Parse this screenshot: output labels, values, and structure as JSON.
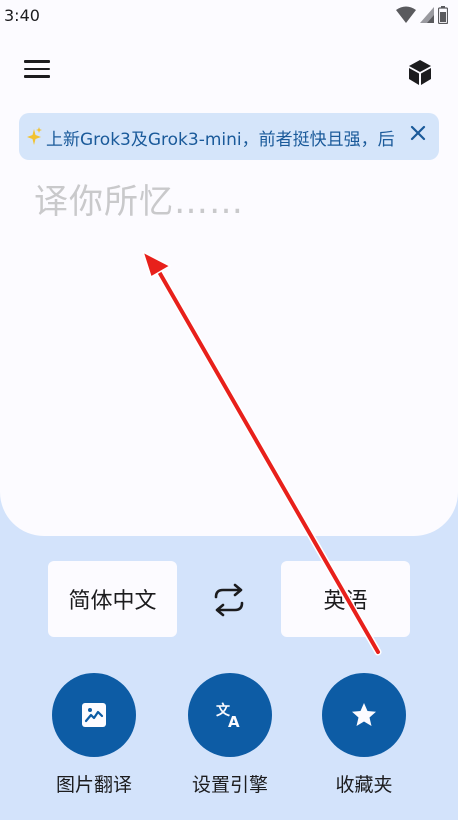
{
  "status": {
    "time": "3:40",
    "icons": [
      "wifi-icon",
      "signal-icon",
      "battery-icon"
    ]
  },
  "header": {
    "menu_icon": "hamburger-menu-icon",
    "right_icon": "cube-icon"
  },
  "announcement": {
    "icon": "sparkle-icon",
    "text": "上新Grok3及Grok3-mini，前者挺快且强，后",
    "close_icon": "close-icon"
  },
  "input": {
    "placeholder": "译你所忆……",
    "value": ""
  },
  "languages": {
    "source": "简体中文",
    "target": "英语",
    "swap_icon": "swap-arrows-icon"
  },
  "actions": [
    {
      "label": "图片翻译",
      "icon": "image-icon"
    },
    {
      "label": "设置引擎",
      "icon": "translate-icon"
    },
    {
      "label": "收藏夹",
      "icon": "star-icon"
    }
  ],
  "colors": {
    "primary": "#0d5ca5",
    "background": "#d3e3fb",
    "surface": "#fcfbff",
    "announcement_bg": "#d5e5fa",
    "annotation_arrow": "#e8201b"
  }
}
